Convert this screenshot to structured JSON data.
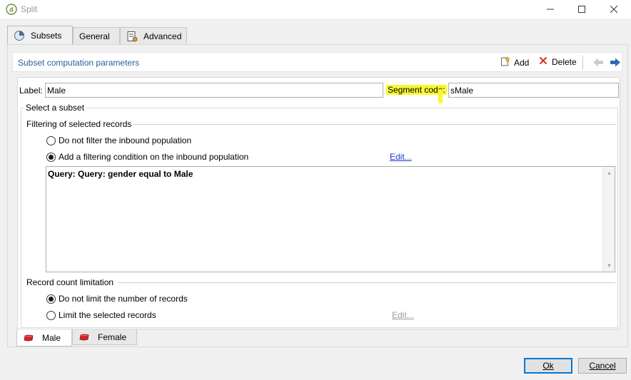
{
  "window": {
    "title": "Split"
  },
  "tabs_top": [
    {
      "label": "Subsets",
      "icon": "pie-chart-icon",
      "active": true
    },
    {
      "label": "General",
      "active": false
    },
    {
      "label": "Advanced",
      "icon": "settings-sheet-icon",
      "active": false
    }
  ],
  "section": {
    "title": "Subset computation parameters",
    "add_label": "Add",
    "delete_label": "Delete"
  },
  "fields": {
    "label_caption": "Label:",
    "label_value": "Male",
    "segment_caption": "Segment code:",
    "segment_value": "sMale"
  },
  "select_subset": {
    "legend": "Select a subset",
    "filtering": {
      "heading": "Filtering of selected records",
      "option_no_filter": "Do not filter the inbound population",
      "option_filter": "Add a filtering condition on the inbound population",
      "selected": "option_filter",
      "edit_link": "Edit...",
      "query_text": "Query: Query: gender equal to Male"
    },
    "record_count": {
      "heading": "Record count limitation",
      "option_no_limit": "Do not limit the number of records",
      "option_limit": "Limit the selected records",
      "selected": "option_no_limit",
      "edit_link": "Edit..."
    }
  },
  "tabs_bottom": [
    {
      "label": "Male",
      "active": true
    },
    {
      "label": "Female",
      "active": false
    }
  ],
  "buttons": {
    "ok": "Ok",
    "cancel": "Cancel"
  },
  "colors": {
    "accent_blue": "#2a5f99",
    "link_blue": "#1a39c9",
    "highlight_yellow": "#f8f832",
    "segment_red": "#d9232a"
  }
}
